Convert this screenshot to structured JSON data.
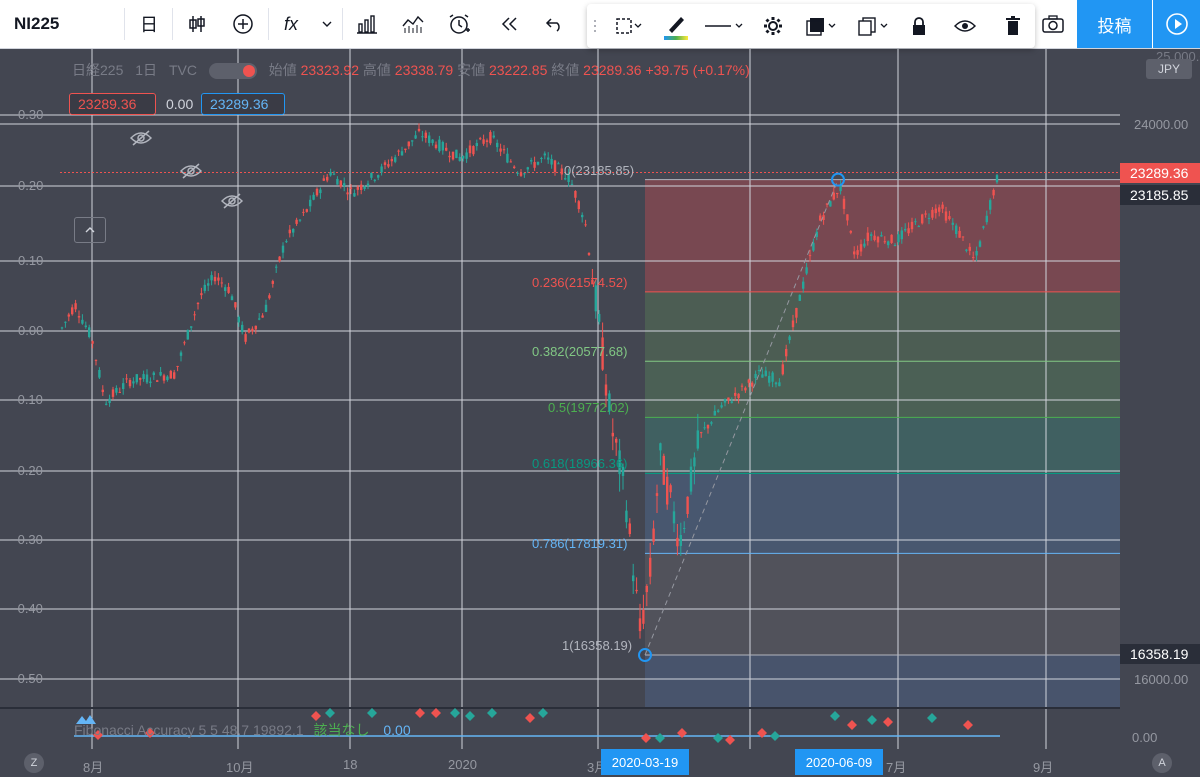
{
  "toolbar": {
    "symbol": "NI225",
    "interval": "日",
    "fx": "fx",
    "post": "投稿"
  },
  "legend": {
    "name": "日経225",
    "interval": "1日",
    "exchange": "TVC",
    "open_label": "始値",
    "open": "23323.92",
    "high_label": "高値",
    "high": "23338.79",
    "low_label": "安値",
    "low": "23222.85",
    "close_label": "終値",
    "close": "23289.36",
    "change": "+39.75 (+0.17%)"
  },
  "boxes": {
    "left": "23289.36",
    "mid": "0.00",
    "right": "23289.36"
  },
  "axis": {
    "currency": "JPY",
    "top_partial": "25,000.00",
    "levels": [
      "24000.00",
      "16000.00",
      "0.00"
    ],
    "tag_close": "23289.36",
    "tag_high": "23185.85",
    "tag_low": "16358.19"
  },
  "left_axis": [
    "0.30",
    "0.20",
    "0.10",
    "0.00",
    "−0.10",
    "−0.20",
    "−0.30",
    "−0.40",
    "−0.50"
  ],
  "fib_levels": [
    {
      "label": "0(23185.85)",
      "color": "#b2b5be"
    },
    {
      "label": "0.236(21574.52)",
      "color": "#ef5350"
    },
    {
      "label": "0.382(20577.68)",
      "color": "#81c784"
    },
    {
      "label": "0.5(19772.02)",
      "color": "#4caf50"
    },
    {
      "label": "0.618(18966.36)",
      "color": "#089981"
    },
    {
      "label": "0.786(17819.31)",
      "color": "#64b5f6"
    },
    {
      "label": "1(16358.19)",
      "color": "#b2b5be"
    }
  ],
  "indicator": {
    "text": "Fibonacci Accuracy 5 5 48.7 19892.1",
    "extra": "該当なし",
    "value": "0.00"
  },
  "time_axis": {
    "labels": [
      "8月",
      "10月",
      "18",
      "2020",
      "3月",
      "7月",
      "9月"
    ],
    "tag1": "2020-03-19",
    "tag2": "2020-06-09",
    "corner_left": "Z",
    "corner_right": "A"
  },
  "colors": {
    "up": "#26a69a",
    "down": "#ef5350",
    "accent": "#2196f3",
    "bg": "#434651"
  }
}
